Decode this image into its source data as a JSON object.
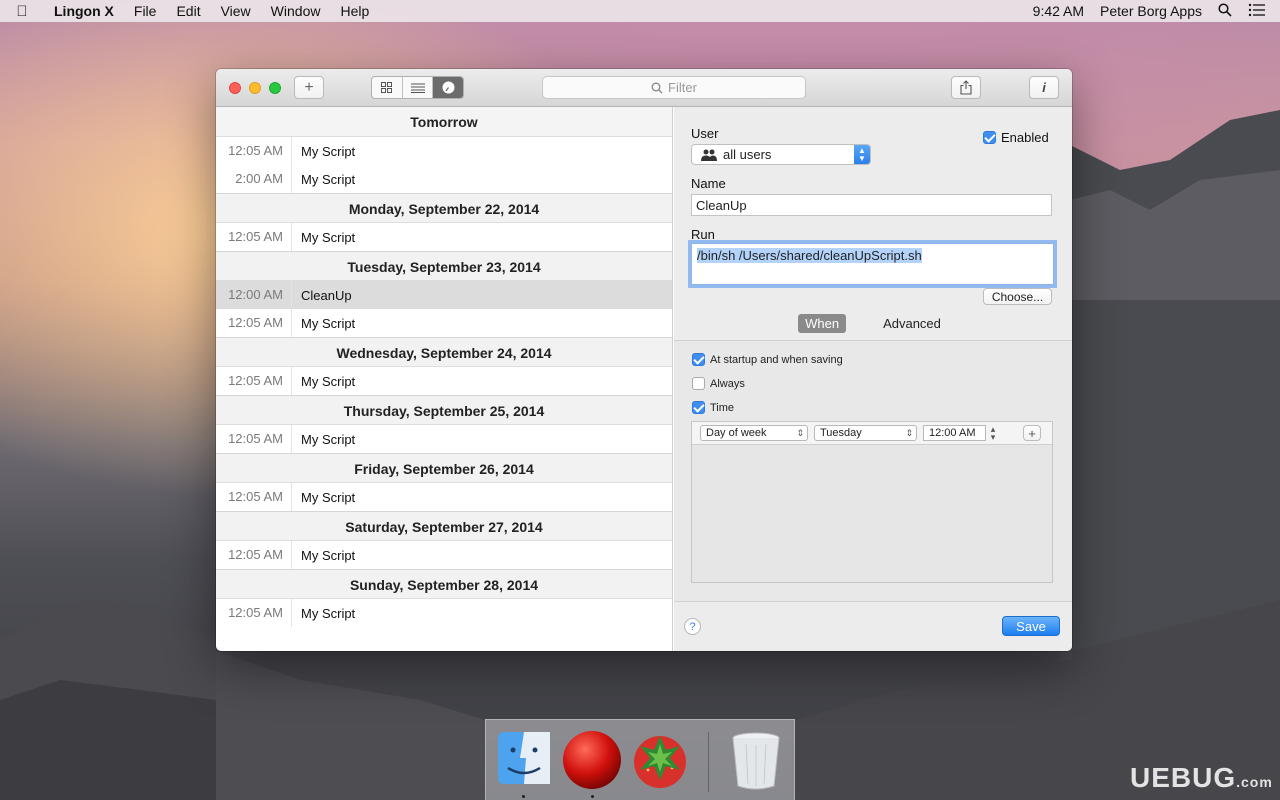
{
  "menubar": {
    "app_name": "Lingon X",
    "menus": [
      "File",
      "Edit",
      "View",
      "Window",
      "Help"
    ],
    "clock": "9:42 AM",
    "user": "Peter Borg Apps"
  },
  "toolbar": {
    "add_label": "+",
    "filter_placeholder": "Filter"
  },
  "schedule": {
    "days": [
      {
        "title": "Tomorrow",
        "items": [
          {
            "time": "12:05 AM",
            "name": "My Script"
          },
          {
            "time": "2:00 AM",
            "name": "My Script"
          }
        ]
      },
      {
        "title": "Monday, September 22, 2014",
        "items": [
          {
            "time": "12:05 AM",
            "name": "My Script"
          }
        ]
      },
      {
        "title": "Tuesday, September 23, 2014",
        "items": [
          {
            "time": "12:00 AM",
            "name": "CleanUp"
          },
          {
            "time": "12:05 AM",
            "name": "My Script"
          }
        ]
      },
      {
        "title": "Wednesday, September 24, 2014",
        "items": [
          {
            "time": "12:05 AM",
            "name": "My Script"
          }
        ]
      },
      {
        "title": "Thursday, September 25, 2014",
        "items": [
          {
            "time": "12:05 AM",
            "name": "My Script"
          }
        ]
      },
      {
        "title": "Friday, September 26, 2014",
        "items": [
          {
            "time": "12:05 AM",
            "name": "My Script"
          }
        ]
      },
      {
        "title": "Saturday, September 27, 2014",
        "items": [
          {
            "time": "12:05 AM",
            "name": "My Script"
          }
        ]
      },
      {
        "title": "Sunday, September 28, 2014",
        "items": [
          {
            "time": "12:05 AM",
            "name": "My Script"
          }
        ]
      }
    ]
  },
  "detail": {
    "user_label": "User",
    "user_value": "all users",
    "enabled_label": "Enabled",
    "name_label": "Name",
    "name_value": "CleanUp",
    "run_label": "Run",
    "run_value": "/bin/sh /Users/shared/cleanUpScript.sh",
    "choose_label": "Choose...",
    "tab_when": "When",
    "tab_advanced": "Advanced",
    "opt_startup": "At startup and when saving",
    "opt_always": "Always",
    "opt_time": "Time",
    "time_mode": "Day of week",
    "time_day": "Tuesday",
    "time_value": "12:00 AM",
    "save_label": "Save",
    "help_label": "?"
  },
  "watermark": {
    "main": "UEBUG",
    "sub": ".com"
  },
  "colors": {
    "accent": "#2a80ea",
    "selection": "#dcdcdc"
  }
}
